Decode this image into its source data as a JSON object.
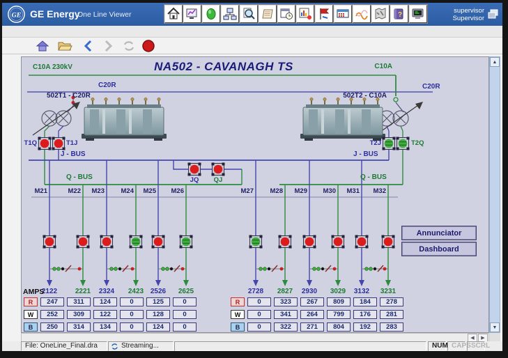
{
  "window": {
    "brand": "GE Energy",
    "app_title": "One Line Viewer",
    "user": {
      "line1": "supervisor",
      "line2": "Supervisor"
    }
  },
  "toolbar": {
    "icons": [
      "home",
      "display-settings",
      "status-indicator",
      "network-explorer",
      "zoom-search",
      "reports",
      "scheduler",
      "chart-viewer",
      "event-painter",
      "data-grid",
      "trend-curves",
      "map-view",
      "help-book",
      "console"
    ]
  },
  "navbar": {
    "icons": [
      "home",
      "open-folder",
      "back",
      "forward",
      "refresh",
      "stop"
    ]
  },
  "diagram": {
    "title": "NA502 - CAVANAGH TS",
    "labels": {
      "c10a_left": "C10A  230kV",
      "c10a_right": "C10A",
      "c20r_left": "C20R",
      "c20r_right": "C20R",
      "t1": "502T1 - C20R",
      "t2": "502T2 - C10A",
      "j_bus_left": "J - BUS",
      "j_bus_right": "J - BUS",
      "q_bus_left": "Q - BUS",
      "q_bus_right": "Q - BUS"
    },
    "breakers": {
      "t1q": {
        "label": "T1Q",
        "state": "closed"
      },
      "t1j": {
        "label": "T1J",
        "state": "closed"
      },
      "t2j": {
        "label": "T2J",
        "state": "open"
      },
      "t2q": {
        "label": "T2Q",
        "state": "open"
      },
      "jq": {
        "label": "JQ",
        "state": "closed"
      },
      "qj": {
        "label": "QJ",
        "state": "closed"
      }
    },
    "state_colors": {
      "closed": "#dc1c1c",
      "open": "#3fae3f"
    },
    "breaker_fills": {
      "t1q": "#dc1c1c",
      "t1j": "#dc1c1c",
      "t2j": "#3fae3f",
      "t2q": "#3fae3f",
      "jq": "#dc1c1c",
      "qj": "#dc1c1c",
      "f1": "#dc1c1c",
      "f2": "#dc1c1c",
      "f3": "#dc1c1c",
      "f4": "#3fae3f",
      "f5": "#dc1c1c",
      "f6": "#3fae3f",
      "f7": "#3fae3f",
      "f8": "#dc1c1c",
      "f9": "#dc1c1c",
      "f10": "#dc1c1c",
      "f11": "#dc1c1c",
      "f12": "#dc1c1c"
    },
    "breaker_stripes": {
      "t1q": "#dc1c1c",
      "t1j": "#dc1c1c",
      "t2j": "#155a1e",
      "t2q": "#155a1e",
      "jq": "#dc1c1c",
      "qj": "#dc1c1c",
      "f1": "#dc1c1c",
      "f2": "#dc1c1c",
      "f3": "#dc1c1c",
      "f4": "#155a1e",
      "f5": "#dc1c1c",
      "f6": "#155a1e",
      "f7": "#155a1e",
      "f8": "#dc1c1c",
      "f9": "#dc1c1c",
      "f10": "#dc1c1c",
      "f11": "#dc1c1c",
      "f12": "#dc1c1c"
    },
    "positions": [
      "M21",
      "M22",
      "M23",
      "M24",
      "M25",
      "M26",
      "M27",
      "M28",
      "M29",
      "M30",
      "M31",
      "M32"
    ],
    "circuits": [
      "2122",
      "2221",
      "2324",
      "2423",
      "2526",
      "2625",
      "2728",
      "2827",
      "2930",
      "3029",
      "3132",
      "3231"
    ],
    "bus_colors": {
      "j_bus": "#4646aa",
      "q_bus": "#2e8b3e"
    }
  },
  "side_buttons": {
    "annunciator": "Annunciator",
    "dashboard": "Dashboard"
  },
  "amps": {
    "header": "AMPS",
    "phases": [
      "R",
      "W",
      "B"
    ],
    "left": [
      [
        "247",
        "311",
        "124",
        "0",
        "125",
        "0"
      ],
      [
        "252",
        "309",
        "122",
        "0",
        "128",
        "0"
      ],
      [
        "250",
        "314",
        "134",
        "0",
        "124",
        "0"
      ]
    ],
    "right": [
      [
        "0",
        "323",
        "267",
        "809",
        "184",
        "278"
      ],
      [
        "0",
        "341",
        "264",
        "799",
        "176",
        "281"
      ],
      [
        "0",
        "322",
        "271",
        "804",
        "192",
        "283"
      ]
    ]
  },
  "statusbar": {
    "file": "File: OneLine_Final.dra",
    "streaming": "Streaming...",
    "locks": [
      "NUM",
      "CAPS",
      "SCRL"
    ]
  }
}
